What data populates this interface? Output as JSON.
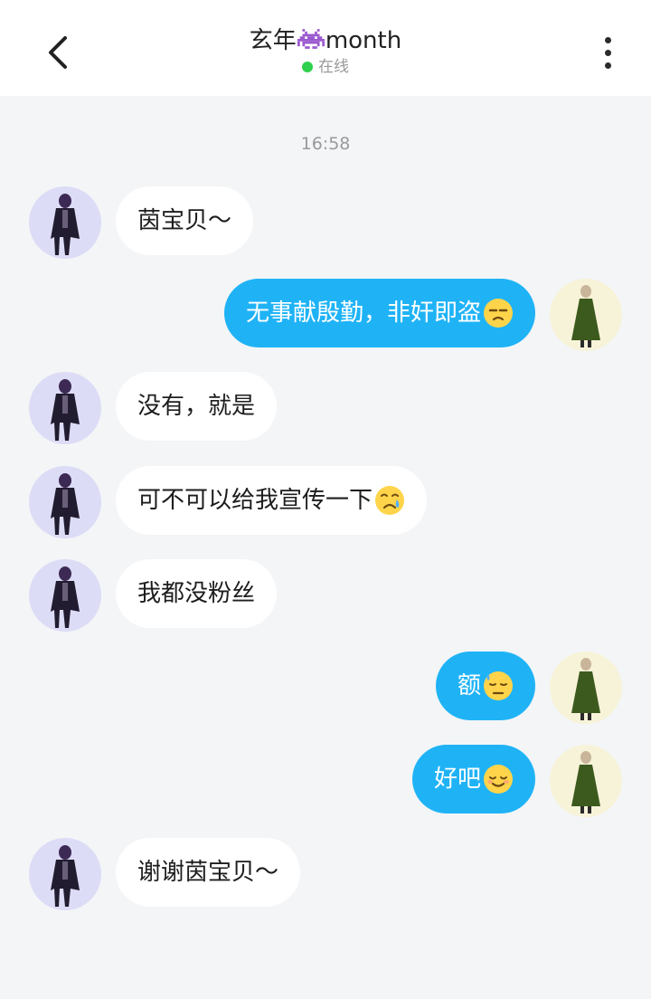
{
  "header": {
    "title_prefix": "玄年",
    "title_icon": "alien-monster-emoji",
    "title_suffix": "month",
    "status": "在线",
    "status_color": "#2fd14c"
  },
  "chat": {
    "timestamp": "16:58",
    "messages": [
      {
        "side": "left",
        "text": "茵宝贝～"
      },
      {
        "side": "right",
        "text": "无事献殷勤，非奸即盗",
        "emoji": "unamused-face"
      },
      {
        "side": "left",
        "text": "没有，就是"
      },
      {
        "side": "left",
        "text": "可不可以给我宣传一下",
        "emoji": "crying-face"
      },
      {
        "side": "left",
        "text": "我都没粉丝"
      },
      {
        "side": "right",
        "text": "额",
        "emoji": "downcast-sweat-face"
      },
      {
        "side": "right",
        "text": "好吧",
        "emoji": "relieved-face"
      },
      {
        "side": "left",
        "text": "谢谢茵宝贝～"
      }
    ]
  },
  "colors": {
    "accent": "#1fb3f6",
    "background": "#f4f5f7",
    "left_avatar_bg": "#dcdcf6",
    "right_avatar_bg": "#f7f3d9"
  }
}
